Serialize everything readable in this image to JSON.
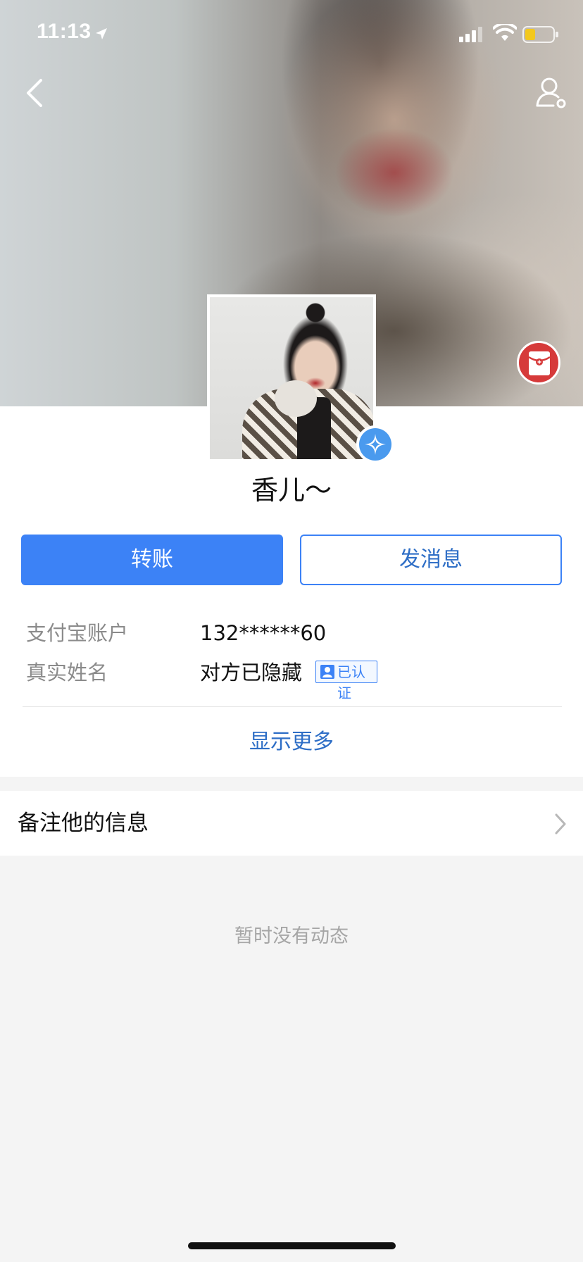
{
  "status_bar": {
    "time": "11:13"
  },
  "header": {
    "back_icon": "chevron-left-icon",
    "settings_icon": "user-settings-icon",
    "red_packet_icon": "red-packet-icon"
  },
  "profile": {
    "nickname": "香儿～",
    "badge_icon": "verified-star-icon"
  },
  "actions": {
    "transfer_label": "转账",
    "message_label": "发消息"
  },
  "info": {
    "rows": [
      {
        "label": "支付宝账户",
        "value": "132******60"
      },
      {
        "label": "真实姓名",
        "value": "对方已隐藏"
      }
    ],
    "verified_tag": "已认证"
  },
  "show_more_label": "显示更多",
  "remark": {
    "label": "备注他的信息"
  },
  "empty_state": "暂时没有动态",
  "colors": {
    "accent": "#3c82f6",
    "link": "#2e6ec6",
    "red_packet": "#d63a3a",
    "page_bg": "#f4f4f4"
  }
}
